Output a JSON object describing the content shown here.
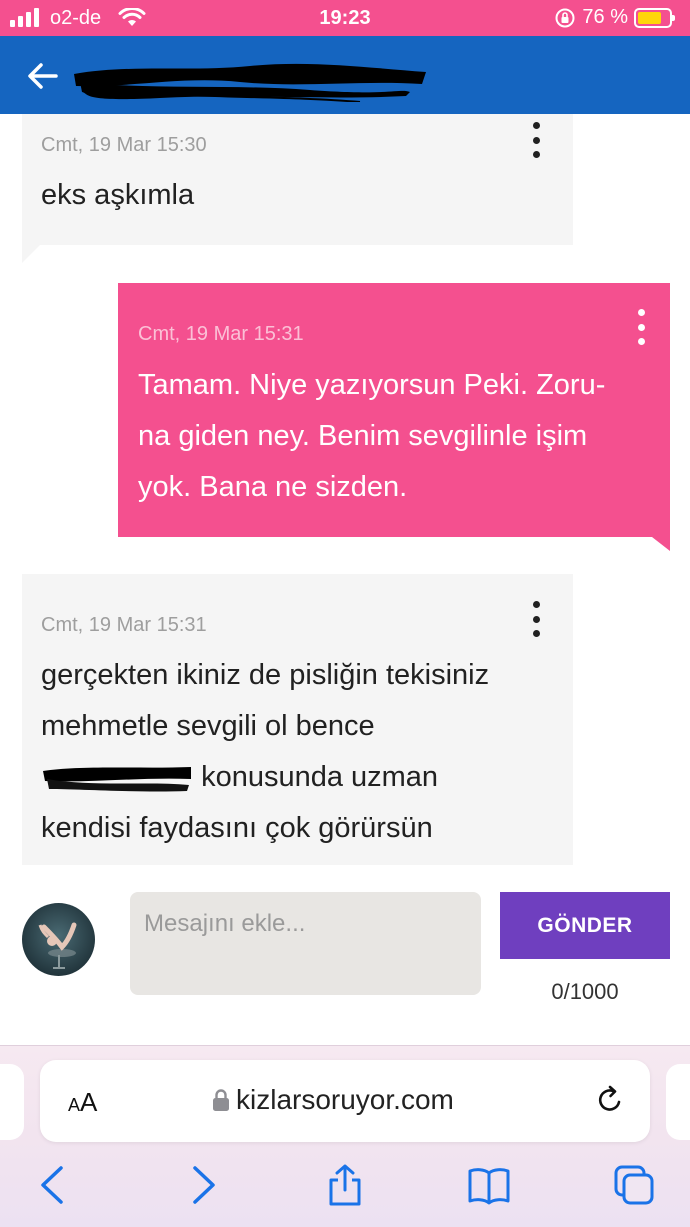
{
  "status_bar": {
    "carrier": "o2-de",
    "time": "19:23",
    "battery_percent": "76 %",
    "battery_level": 0.76,
    "battery_color": "#ffd60a"
  },
  "app_bar": {
    "back_icon": "arrow-left-icon",
    "color": "#1565c0"
  },
  "messages": [
    {
      "direction": "incoming",
      "time": "Cmt, 19 Mar 15:30",
      "lines": [
        "eks aşkımla"
      ]
    },
    {
      "direction": "outgoing",
      "time": "Cmt, 19 Mar 15:31",
      "lines": [
        "Tamam. Niye yazıyorsun Peki. Zoru-",
        "na giden ney. Benim sevgilinle işim",
        "yok. Bana ne sizden."
      ]
    },
    {
      "direction": "incoming",
      "time": "Cmt, 19 Mar 15:31",
      "lines": [
        "gerçekten ikiniz de pisliğin tekisiniz",
        "mehmetle sevgili ol bence",
        "konusunda uzman",
        "kendisi faydasını çok görürsün"
      ]
    }
  ],
  "compose": {
    "placeholder": "Mesajını ekle...",
    "send_label": "GÖNDER",
    "char_count": "0/1000",
    "send_color": "#6f3fbf"
  },
  "browser": {
    "text_size_label_small": "A",
    "text_size_label_large": "A",
    "url": "kizlarsoruyor.com",
    "toolbar_icons": [
      "back-icon",
      "forward-icon",
      "share-icon",
      "bookmarks-icon",
      "tabs-icon"
    ]
  },
  "colors": {
    "accent_pink": "#f4508f",
    "app_blue": "#1565c0",
    "safari_blue": "#1a73e8"
  }
}
